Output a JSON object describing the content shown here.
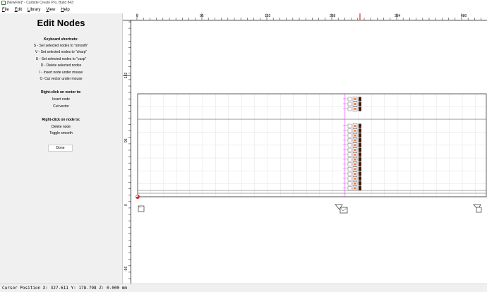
{
  "window": {
    "title": "[NewFile]* - Carbide Create Pro, Build 843"
  },
  "menu": {
    "items": [
      "File",
      "Edit",
      "Library",
      "View",
      "Help"
    ]
  },
  "panel": {
    "heading": "Edit Nodes",
    "shortcuts_title": "Keyboard shortcuts:",
    "shortcuts": [
      "S - Set selected nodes to \"smooth\"",
      "V - Set selected nodes to \"sharp\"",
      "U - Set selected nodes to \"cusp\"",
      "D - Delete selected nodes",
      "I - Insert node under mouse",
      "C- Cut vector under mouse"
    ],
    "vector_title": "Right-click on vector to:",
    "vector_actions": [
      "Insert node",
      "Cut vector"
    ],
    "node_title": "Right-click on node to:",
    "node_actions": [
      "Delete node",
      "Toggle smooth"
    ],
    "done_label": "Done"
  },
  "rulers": {
    "top": [
      "0",
      "96",
      "192",
      "288",
      "384",
      "480"
    ],
    "left": [
      "192",
      "96",
      "0",
      "-96"
    ]
  },
  "status": {
    "cursor_position": "Cursor Position X: 327.611 Y: 178.798 Z: 0.000 mm"
  },
  "colors": {
    "accent": "#d32f2f",
    "node_fill": "#3a1e12",
    "node_magenta": "#e040fb",
    "grid": "#e6e6e6"
  }
}
